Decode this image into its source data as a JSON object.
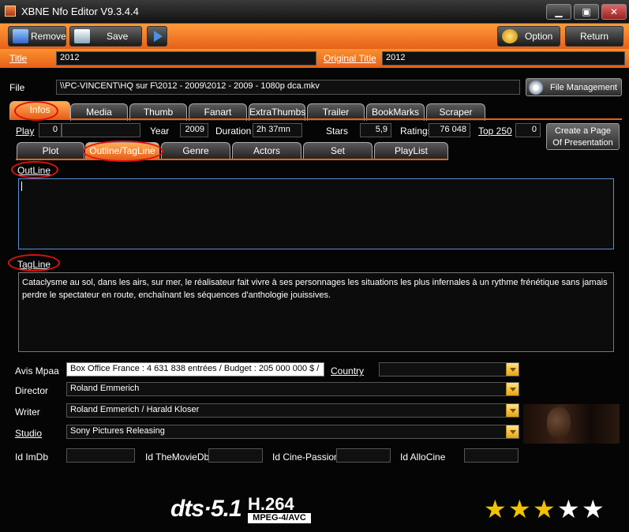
{
  "window": {
    "title": "XBNE Nfo Editor V9.3.4.4",
    "minimize": "▁",
    "maximize": "▣",
    "close": "✕"
  },
  "toolbar": {
    "remove": "Remove",
    "save": "Save",
    "option": "Option",
    "return": "Return"
  },
  "header": {
    "title_label": "Title",
    "title_value": "2012",
    "original_title_label": "Original Title",
    "original_title_value": "2012"
  },
  "file": {
    "label": "File",
    "path": "\\\\PC-VINCENT\\HQ sur F\\2012 - 2009\\2012 - 2009 - 1080p dca.mkv",
    "management_button": "File Management"
  },
  "main_tabs": [
    "Infos",
    "Media",
    "Thumb",
    "Fanart",
    "ExtraThumbs",
    "Trailer",
    "BookMarks",
    "Scraper"
  ],
  "info_row": {
    "play_label": "Play",
    "play_value": "0",
    "play_extra": "",
    "year_label": "Year",
    "year_value": "2009",
    "duration_label": "Duration",
    "duration_value": "2h 37mn",
    "stars_label": "Stars",
    "stars_value": "5,9",
    "ratings_label": "Ratings",
    "ratings_value": "76 048",
    "top250_label": "Top 250",
    "top250_value": "0",
    "create_page_line1": "Create a Page",
    "create_page_line2": "Of Presentation"
  },
  "sub_tabs": [
    "Plot",
    "Outline/TagLine",
    "Genre",
    "Actors",
    "Set",
    "PlayList"
  ],
  "outline": {
    "label": "OutLine",
    "value": ""
  },
  "tagline": {
    "label": "TagLine",
    "value": "Cataclysme au sol, dans les airs, sur mer, le réalisateur fait vivre à ses personnages les situations les plus infernales à un rythme frénétique sans jamais perdre le spectateur en route, enchaînant les séquences d'anthologie jouissives."
  },
  "fields": {
    "avis_mpaa_label": "Avis Mpaa",
    "avis_mpaa_value": "Box Office France : 4 631 838 entrées / Budget : 205 000 000 $ /",
    "country_label": "Country",
    "country_value": "",
    "director_label": "Director",
    "director_value": "Roland Emmerich",
    "writer_label": "Writer",
    "writer_value": "Roland Emmerich / Harald Kloser",
    "studio_label": "Studio",
    "studio_value": "Sony Pictures Releasing"
  },
  "ids": {
    "imdb_label": "Id ImDb",
    "imdb_value": "",
    "tmdb_label": "Id TheMovieDb",
    "tmdb_value": "",
    "cine_passion_label": "Id Cine-Passion",
    "cine_passion_value": "",
    "allocine_label": "Id AlloCine",
    "allocine_value": ""
  },
  "logos": {
    "audio": "dts·5.1",
    "video_top": "H.264",
    "video_bottom": "MPEG-4/AVC"
  },
  "rating_stars": {
    "filled": 3,
    "total": 5
  },
  "colors": {
    "accent": "#e8601a",
    "highlight_circle": "#e01010",
    "star_filled": "#f2c200",
    "star_empty": "#ffffff"
  }
}
